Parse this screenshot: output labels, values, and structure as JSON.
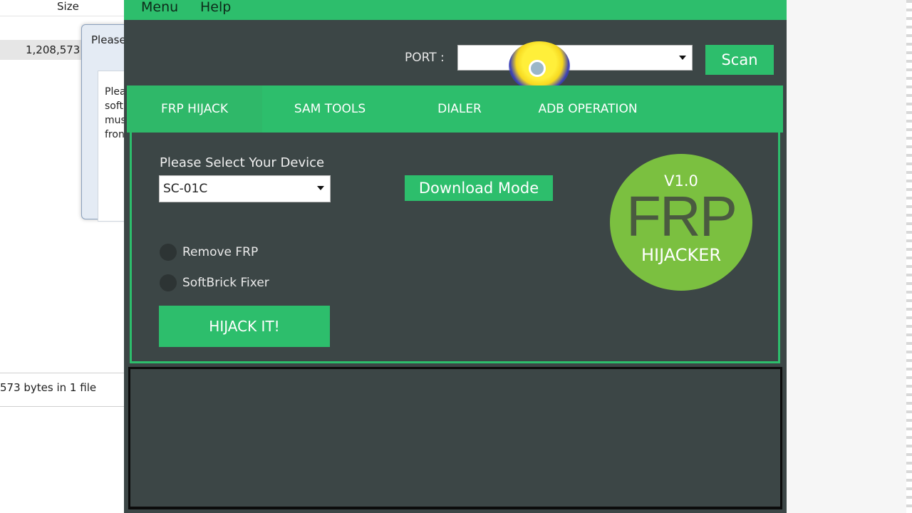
{
  "explorer": {
    "column_size": "Size",
    "file_size": "1,208,573",
    "status": "573 bytes in 1 file"
  },
  "dialog": {
    "title": "Please",
    "body": [
      "Plea",
      "soft",
      "mus",
      "fron"
    ]
  },
  "app": {
    "menu": [
      "Menu",
      "Help"
    ],
    "port_label": "PORT :",
    "port_value": "",
    "scan_label": "Scan",
    "tabs": [
      {
        "label": "FRP HIJACK",
        "active": true
      },
      {
        "label": "SAM TOOLS",
        "active": false
      },
      {
        "label": "DIALER",
        "active": false
      },
      {
        "label": "ADB OPERATION",
        "active": false
      }
    ],
    "device_label": "Please Select Your Device",
    "device_value": "SC-01C",
    "download_label": "Download Mode",
    "options": [
      {
        "label": "Remove FRP",
        "checked": false
      },
      {
        "label": "SoftBrick Fixer",
        "checked": false
      }
    ],
    "hijack_label": "HIJACK IT!",
    "logo": {
      "version": "V1.0",
      "title": "FRP",
      "subtitle": "HIJACKER"
    },
    "colors": {
      "accent": "#2dbe6c",
      "background": "#3c4646",
      "logo": "#7bc040"
    }
  }
}
